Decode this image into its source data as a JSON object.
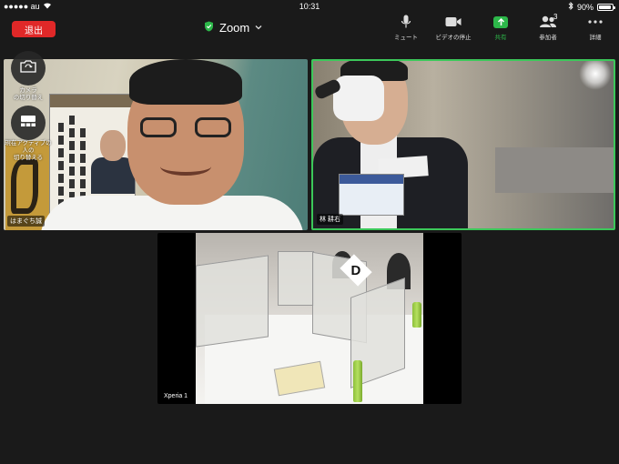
{
  "status_bar": {
    "carrier": "●●●●● au",
    "time": "10:31",
    "battery": "90%",
    "battery_level": 0.9
  },
  "header": {
    "leave_label": "退出",
    "meeting_title": "Zoom"
  },
  "toolbar": {
    "items": [
      {
        "label": "ミュート",
        "icon": "microphone-icon"
      },
      {
        "label": "ビデオの停止",
        "icon": "video-camera-icon"
      },
      {
        "label": "共有",
        "icon": "share-arrow-icon"
      },
      {
        "label": "参加者",
        "icon": "participants-icon",
        "count": "3"
      },
      {
        "label": "詳細",
        "icon": "more-dots-icon"
      }
    ]
  },
  "side_controls": {
    "camera_switch_label": "カメラ\nの切り替え",
    "layout_switch_label": "現在アクティブの\n人の\n切り替える"
  },
  "tiles": [
    {
      "name": "はまぐち誠"
    },
    {
      "name": "林 耕右",
      "active": true
    },
    {
      "name": "Xperia 1"
    }
  ],
  "scene": {
    "sign_letter": "D"
  },
  "colors": {
    "leave": "#e02828",
    "share": "#2db84a",
    "active_border": "#3cc85a",
    "background": "#1a1a1a"
  }
}
